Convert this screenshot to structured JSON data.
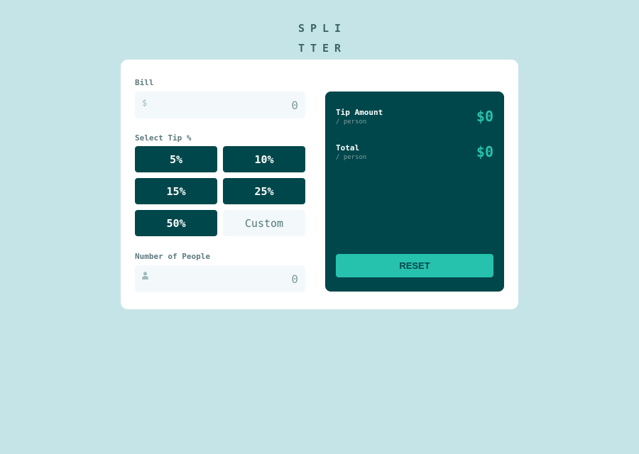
{
  "logo": {
    "line1": "SPLI",
    "line2": "TTER"
  },
  "bill": {
    "label": "Bill",
    "currency_icon": "$",
    "placeholder": "0"
  },
  "tip": {
    "label": "Select Tip %",
    "options": [
      "5%",
      "10%",
      "15%",
      "25%",
      "50%"
    ],
    "custom_placeholder": "Custom"
  },
  "people": {
    "label": "Number of People",
    "icon": "person-icon",
    "placeholder": "0"
  },
  "results": {
    "tip_amount": {
      "title": "Tip Amount",
      "sub": "/ person",
      "value": "$0"
    },
    "total": {
      "title": "Total",
      "sub": "/ person",
      "value": "$0"
    },
    "reset_label": "RESET"
  },
  "colors": {
    "background": "#c5e4e7",
    "dark_green": "#00474b",
    "accent": "#26c2ad",
    "input_bg": "#f3f9fa"
  }
}
